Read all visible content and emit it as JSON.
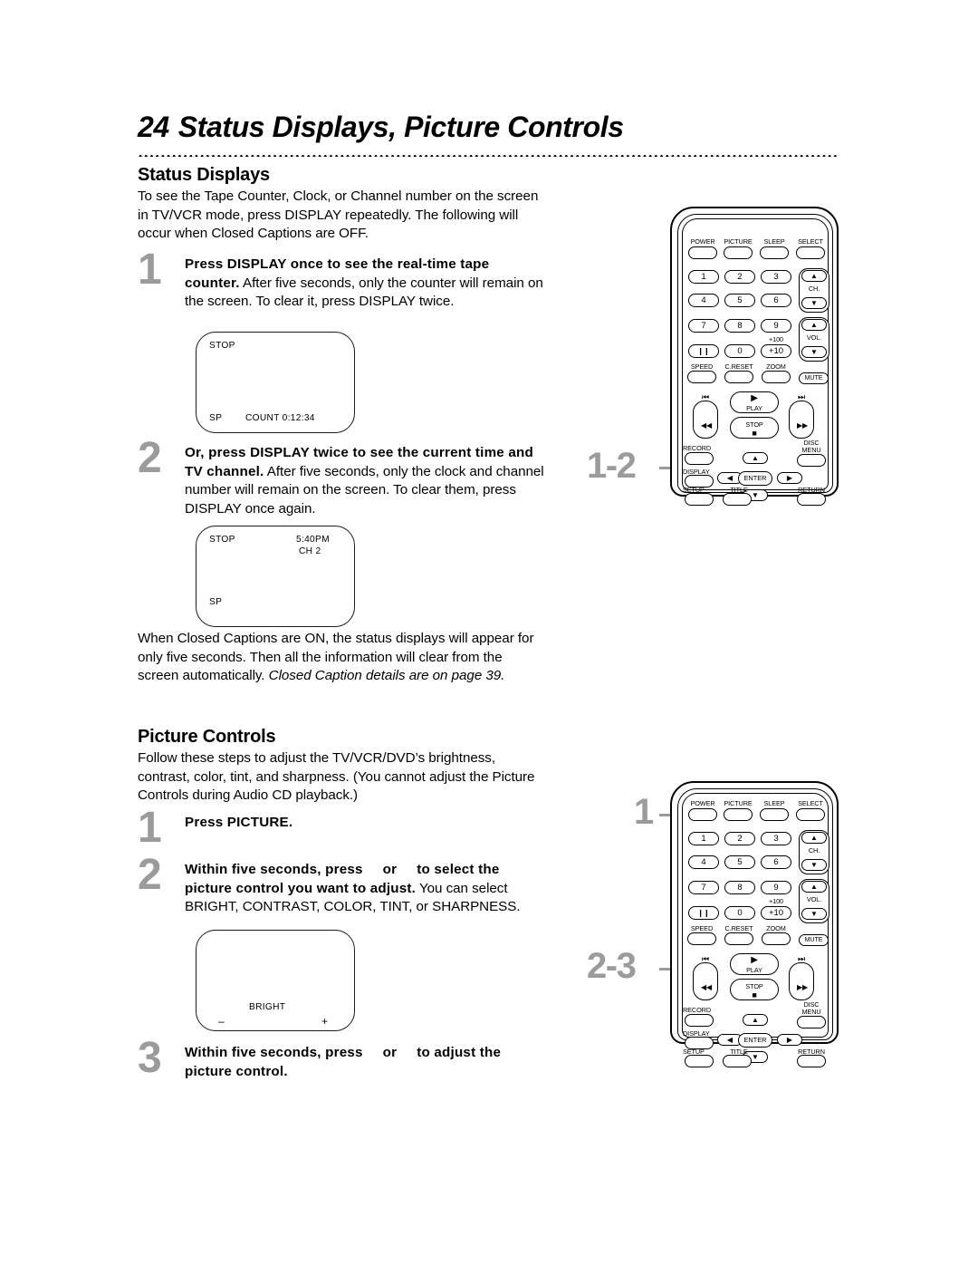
{
  "header": {
    "page_number": "24",
    "title": "Status Displays, Picture Controls"
  },
  "sections": [
    {
      "heading": "Status Displays",
      "intro": "To see the Tape Counter, Clock, or Channel number on the screen in TV/VCR mode, press DISPLAY repeatedly. The following will occur when Closed Captions are OFF."
    },
    {
      "heading": "Picture Controls",
      "intro": "Follow these steps to adjust the TV/VCR/DVD’s brightness, contrast, color, tint, and sharpness. (You cannot adjust the Picture Controls during Audio CD playback.)"
    }
  ],
  "steps": {
    "status_1": {
      "number": "1",
      "bold": "Press DISPLAY once to see the real-time tape counter.",
      "rest": " After five seconds, only the counter will remain on the screen. To clear it, press DISPLAY twice."
    },
    "status_2": {
      "number": "2",
      "bold": "Or, press DISPLAY twice to see the current time and TV channel.",
      "rest": " After five seconds, only the clock and channel number will remain on the screen. To clear them, press DISPLAY once again."
    },
    "picture_1": {
      "number": "1",
      "bold": "Press PICTURE.",
      "rest": ""
    },
    "picture_2": {
      "number": "2",
      "bold_a": "Within five seconds, press",
      "bold_or": "or",
      "bold_b": "to select the picture control you want to adjust.",
      "rest": " You can select BRIGHT, CONTRAST, COLOR, TINT, or SHARPNESS."
    },
    "picture_3": {
      "number": "3",
      "bold_a": "Within five seconds, press",
      "bold_or": "or",
      "bold_b": "to adjust the picture control.",
      "rest": ""
    }
  },
  "closed_caption_note": {
    "plain": "When Closed Captions are ON, the status displays will appear for only five seconds. Then all the information will clear from the screen automatically. ",
    "italic": "Closed Caption details are on page 39."
  },
  "tv_screens": {
    "counter": {
      "top_left": "STOP",
      "bottom_left": "SP",
      "bottom_center": "COUNT  0:12:34"
    },
    "clock_channel": {
      "top_left": "STOP",
      "top_right_time": "5:40PM",
      "top_right_channel": "CH   2",
      "bottom_left": "SP"
    },
    "bright": {
      "label": "BRIGHT",
      "minus": "–",
      "plus": "+"
    }
  },
  "remote": {
    "top_row": [
      "POWER",
      "PICTURE",
      "SLEEP",
      "SELECT"
    ],
    "keypad": [
      "1",
      "2",
      "3",
      "4",
      "5",
      "6",
      "7",
      "8",
      "9"
    ],
    "pause_key": "❙❙",
    "zero_key": "0",
    "plus100_label": "+100",
    "plus10_key": "+10",
    "ch_label": "CH.",
    "vol_label": "VOL.",
    "up_glyph": "▲",
    "down_glyph": "▼",
    "left_glyph": "◀",
    "right_glyph": "▶",
    "fn_row": [
      "SPEED",
      "C.RESET",
      "ZOOM"
    ],
    "mute": "MUTE",
    "transport": {
      "prev": "⏮",
      "next": "⏭",
      "rew": "◀◀",
      "ffwd": "▶▶",
      "play_glyph": "▶",
      "play_label": "PLAY",
      "stop_label": "STOP",
      "stop_glyph": "■"
    },
    "record": "RECORD",
    "disc_menu_line1": "DISC",
    "disc_menu_line2": "MENU",
    "display": "DISPLAY",
    "setup": "SETUP",
    "title": "TITLE",
    "return": "RETURN",
    "enter": "ENTER"
  },
  "callouts": {
    "status": "1-2",
    "picture_first": "1",
    "picture_second": "2-3"
  },
  "colors": {
    "callout_gray": "#9b9b9b",
    "ink": "#000000",
    "paper": "#ffffff"
  }
}
